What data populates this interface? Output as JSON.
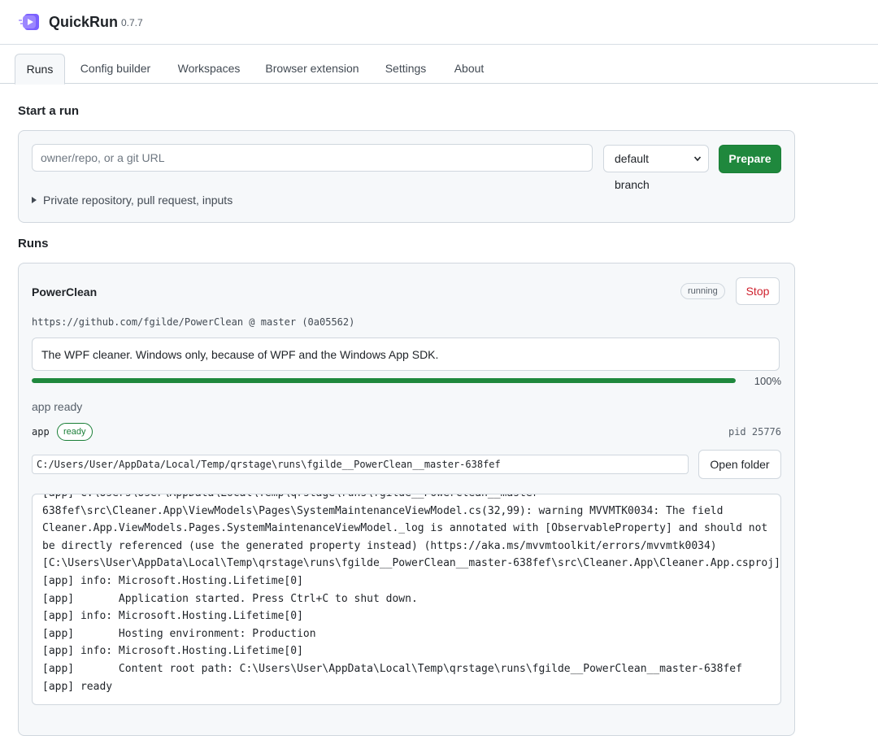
{
  "header": {
    "app_name": "QuickRun",
    "version": "0.7.7",
    "logo_icon": "quickrun-logo-icon"
  },
  "tabs": [
    {
      "label": "Runs",
      "active": true
    },
    {
      "label": "Config builder",
      "active": false
    },
    {
      "label": "Workspaces",
      "active": false
    },
    {
      "label": "Browser extension",
      "active": false
    },
    {
      "label": "Settings",
      "active": false
    },
    {
      "label": "About",
      "active": false
    }
  ],
  "start_run": {
    "title": "Start a run",
    "repo_placeholder": "owner/repo, or a git URL",
    "repo_value": "",
    "branch_selected": "default branch",
    "prepare_label": "Prepare",
    "advanced_label": "Private repository, pull request, inputs"
  },
  "runs": {
    "title": "Runs",
    "items": [
      {
        "name": "PowerClean",
        "status": "running",
        "stop_label": "Stop",
        "source": "https://github.com/fgilde/PowerClean @ master (0a05562)",
        "description": "The WPF cleaner. Windows only, because of WPF and the Windows App SDK.",
        "progress_percent": 100,
        "progress_label": "100%",
        "stage": "app ready",
        "process": {
          "name": "app",
          "state": "ready",
          "pid_label": "pid 25776",
          "path": "C:/Users/User/AppData/Local/Temp/qrstage\\runs\\fgilde__PowerClean__master-638fef",
          "open_folder_label": "Open folder"
        },
        "log_lines": [
          "[app] C:\\Users\\User\\AppData\\Local\\Temp\\qrstage\\runs\\fgilde__PowerClean__master-",
          "638fef\\src\\Cleaner.App\\ViewModels\\Pages\\SystemMaintenanceViewModel.cs(32,99): warning MVVMTK0034: The field",
          "Cleaner.App.ViewModels.Pages.SystemMaintenanceViewModel._log is annotated with [ObservableProperty] and should not",
          "be directly referenced (use the generated property instead) (https://aka.ms/mvvmtoolkit/errors/mvvmtk0034)",
          "[C:\\Users\\User\\AppData\\Local\\Temp\\qrstage\\runs\\fgilde__PowerClean__master-638fef\\src\\Cleaner.App\\Cleaner.App.csproj]",
          "[app] info: Microsoft.Hosting.Lifetime[0]",
          "[app]       Application started. Press Ctrl+C to shut down.",
          "[app] info: Microsoft.Hosting.Lifetime[0]",
          "[app]       Hosting environment: Production",
          "[app] info: Microsoft.Hosting.Lifetime[0]",
          "[app]       Content root path: C:\\Users\\User\\AppData\\Local\\Temp\\qrstage\\runs\\fgilde__PowerClean__master-638fef",
          "[app] ready"
        ]
      }
    ]
  },
  "colors": {
    "accent": "#1f883d",
    "danger": "#cf222e",
    "logo": "#7b61ff"
  }
}
